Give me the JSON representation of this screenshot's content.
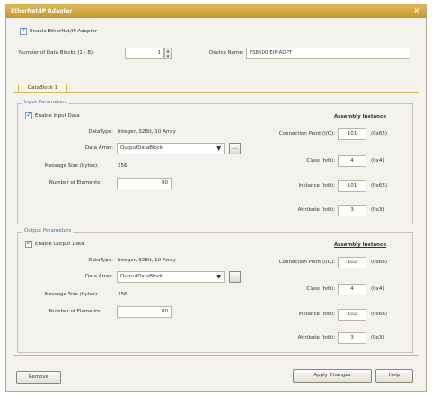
{
  "window": {
    "title": "EtherNet/IP Adapter"
  },
  "enable_adapter": {
    "label": "Enable EtherNet/IP Adapter",
    "checked": true
  },
  "datablocks": {
    "label": "Number of Data Blocks (1 - 8):",
    "value": "1"
  },
  "device_name": {
    "label": "Device Name:",
    "value": "FS8500 EIP ADPT"
  },
  "tab": {
    "label": "DataBlock 1"
  },
  "input": {
    "section_label": "Input Parameters",
    "enable": {
      "label": "Enable Input Data",
      "checked": true
    },
    "datatype_label": "DataType:",
    "datatype_value": "Integer, 32Bit, 10 Array",
    "data_array_label": "Data Array:",
    "data_array_value": "OutputDataBlock",
    "message_size_label": "Message Size (bytes):",
    "message_size_value": "256",
    "num_elements_label": "Number of Elements:",
    "num_elements_value": "80",
    "assembly_header": "Assembly Instance",
    "connection_point_label": "Connection Point (I/O):",
    "connection_point_value": "101",
    "connection_point_hex": "(0x65)",
    "class_label": "Class (hdr):",
    "class_value": "4",
    "class_hex": "(0x4)",
    "instance_label": "Instance (hdr):",
    "instance_value": "101",
    "instance_hex": "(0x65)",
    "attribute_label": "Attribute (hdr):",
    "attribute_value": "3",
    "attribute_hex": "(0x3)"
  },
  "output": {
    "section_label": "Output Parameters",
    "enable": {
      "label": "Enable Output Data",
      "checked": true
    },
    "datatype_label": "DataType:",
    "datatype_value": "Integer, 32Bit, 10 Array",
    "data_array_label": "Data Array:",
    "data_array_value": "OutputDataBlock",
    "message_size_label": "Message Size (bytes):",
    "message_size_value": "356",
    "num_elements_label": "Number of Elements:",
    "num_elements_value": "80",
    "assembly_header": "Assembly Instance",
    "connection_point_label": "Connection Point (I/O):",
    "connection_point_value": "102",
    "connection_point_hex": "(0x66)",
    "class_label": "Class (hdr):",
    "class_value": "4",
    "class_hex": "(0x4)",
    "instance_label": "Instance (hdr):",
    "instance_value": "102",
    "instance_hex": "(0x66)",
    "attribute_label": "Attribute (hdr):",
    "attribute_value": "3",
    "attribute_hex": "(0x3)"
  },
  "buttons": {
    "remove": "Remove",
    "apply": "Apply Changes",
    "help": "Help",
    "ellipsis": "..."
  },
  "icons": {
    "close": "close-icon",
    "dropdown": "chevron-down-icon",
    "spin_up": "spin-up-icon",
    "spin_down": "spin-down-icon"
  },
  "colors": {
    "title_bar": "#c9992e",
    "section_title": "#3f6fb0",
    "tab_border": "#d9b45e"
  }
}
